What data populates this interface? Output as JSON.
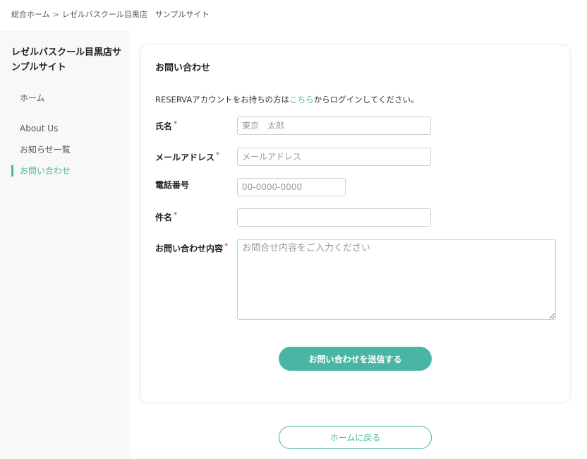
{
  "breadcrumb": {
    "home": "総合ホーム",
    "separator": ">",
    "current": "レゼルバスクール目黒店　サンプルサイト"
  },
  "sidebar": {
    "title": "レゼルバスクール目黒店サンプルサイト",
    "items": [
      {
        "label": "ホーム",
        "active": false
      },
      {
        "label": "About Us",
        "active": false
      },
      {
        "label": "お知らせ一覧",
        "active": false
      },
      {
        "label": "お問い合わせ",
        "active": true
      }
    ]
  },
  "form": {
    "title": "お問い合わせ",
    "intro_prefix": "RESERVAアカウントをお持ちの方は",
    "intro_link": "こちら",
    "intro_suffix": "からログインしてください。",
    "required_mark": "*",
    "fields": {
      "name": {
        "label": "氏名",
        "placeholder": "東京　太郎"
      },
      "email": {
        "label": "メールアドレス",
        "placeholder": "メールアドレス"
      },
      "phone": {
        "label": "電話番号",
        "placeholder": "00-0000-0000"
      },
      "subject": {
        "label": "件名",
        "placeholder": ""
      },
      "message": {
        "label": "お問い合わせ内容",
        "placeholder": "お問合せ内容をご入力ください"
      }
    },
    "submit_label": "お問い合わせを送信する"
  },
  "footer": {
    "home_label": "ホームに戻る"
  },
  "colors": {
    "accent": "#4ab5a4",
    "required": "#e06060"
  }
}
